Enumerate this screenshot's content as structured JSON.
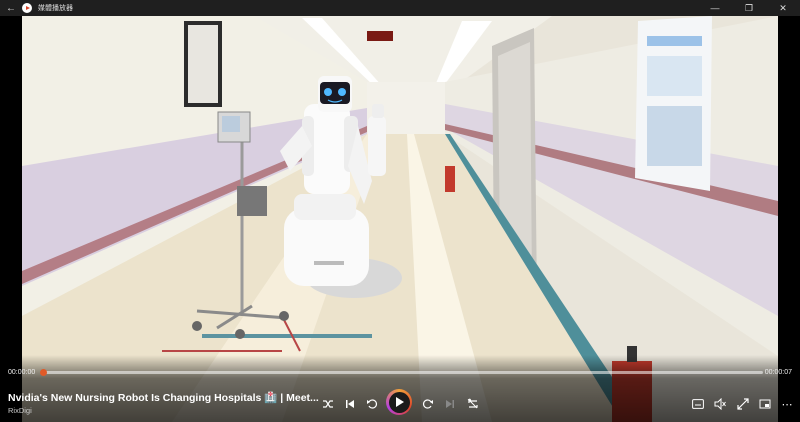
{
  "window": {
    "title": "媒體播放器",
    "back_icon": "back-arrow-icon",
    "minimize_icon": "minimize-icon",
    "maximize_icon": "maximize-icon",
    "close_icon": "close-icon"
  },
  "player": {
    "current_time": "00:00:00",
    "duration": "00:00:07",
    "progress": 0.0,
    "accent_color": "#e05a28",
    "media_title": "Nvidia's New Nursing Robot Is Changing Hospitals 🏥 | Meet...",
    "channel": "RixDigi"
  },
  "controls": {
    "shuffle_icon": "shuffle-icon",
    "previous_icon": "previous-track-icon",
    "rewind_icon": "skip-back-10-icon",
    "play_icon": "play-icon",
    "forward_icon": "skip-forward-30-icon",
    "next_icon": "next-track-icon",
    "repeat_icon": "repeat-icon",
    "captions_icon": "captions-icon",
    "volume_icon": "volume-mute-icon",
    "fullscreen_icon": "fullscreen-icon",
    "miniplayer_icon": "mini-player-icon",
    "more_icon": "more-options-icon"
  }
}
